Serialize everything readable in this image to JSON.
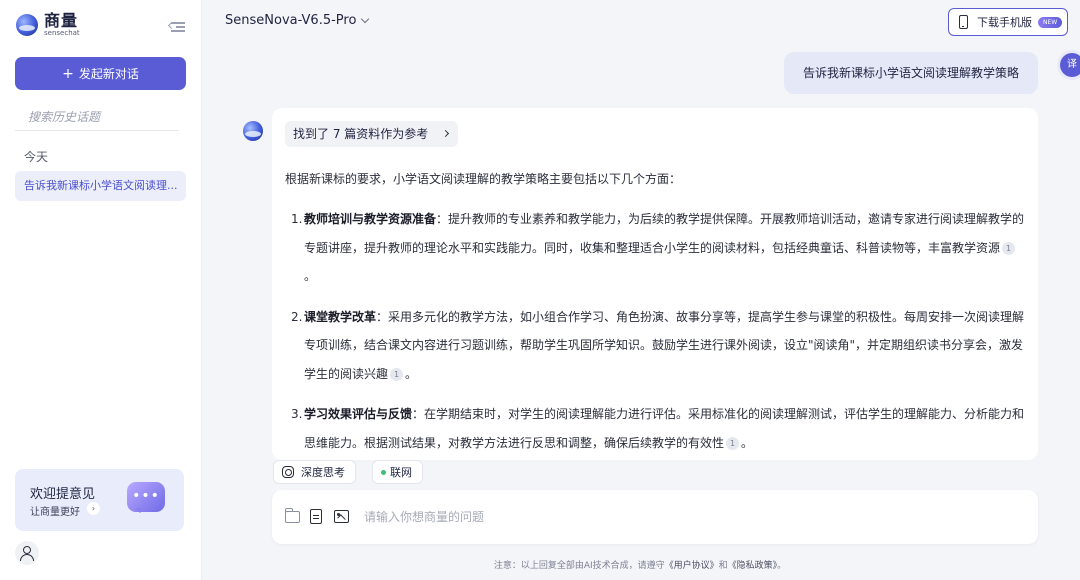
{
  "sidebar": {
    "logo_cn": "商量",
    "logo_en": "sensechat",
    "new_chat_label": "发起新对话",
    "search_placeholder": "搜索历史话题",
    "today_label": "今天",
    "history_items": [
      {
        "label": "告诉我新课标小学语文阅读理..."
      }
    ],
    "feedback": {
      "title": "欢迎提意见",
      "subtitle": "让商量更好",
      "icon": "chat-bubble-icon"
    }
  },
  "header": {
    "model_name": "SenseNova-V6.5-Pro",
    "download_label": "下载手机版",
    "new_badge": "NEW",
    "translate_label": "译"
  },
  "chat": {
    "user_message": "告诉我新课标小学语文阅读理解教学策略",
    "refs_label": "找到了 7 篇资料作为参考",
    "intro": "根据新课标的要求，小学语文阅读理解的教学策略主要包括以下几个方面：",
    "points": [
      {
        "num": "1.",
        "title": "教师培训与教学资源准备",
        "text": "：提升教师的专业素养和教学能力，为后续的教学提供保障。开展教师培训活动，邀请专家进行阅读理解教学的专题讲座，提升教师的理论水平和实践能力。同时，收集和整理适合小学生的阅读材料，包括经典童话、科普读物等，丰富教学资源",
        "cite": "1",
        "end": "。"
      },
      {
        "num": "2.",
        "title": "课堂教学改革",
        "text": "：采用多元化的教学方法，如小组合作学习、角色扮演、故事分享等，提高学生参与课堂的积极性。每周安排一次阅读理解专项训练，结合课文内容进行习题训练，帮助学生巩固所学知识。鼓励学生进行课外阅读，设立\"阅读角\"，并定期组织读书分享会，激发学生的阅读兴趣",
        "cite": "1",
        "end": "。"
      },
      {
        "num": "3.",
        "title": "学习效果评估与反馈",
        "text": "：在学期结束时，对学生的阅读理解能力进行评估。采用标准化的阅读理解测试，评估学生的理解能力、分析能力和思维能力。根据测试结果，对教学方法进行反思和调整，确保后续教学的有效性",
        "cite": "1",
        "end": "。"
      }
    ]
  },
  "composer": {
    "deep_think_label": "深度思考",
    "web_label": "联网",
    "placeholder": "请输入你想商量的问题"
  },
  "footer": {
    "prefix": "注意：以上回复全部由AI技术合成，请遵守",
    "user_agreement": "《用户协议》",
    "and": "和",
    "privacy": "《隐私政策》",
    "suffix": "。"
  },
  "colors": {
    "accent": "#5a5cd6",
    "sidebar_bg": "#ffffff",
    "main_bg": "#f4f5f9",
    "user_bubble": "#e5e8f7",
    "history_active": "#eceffa"
  }
}
